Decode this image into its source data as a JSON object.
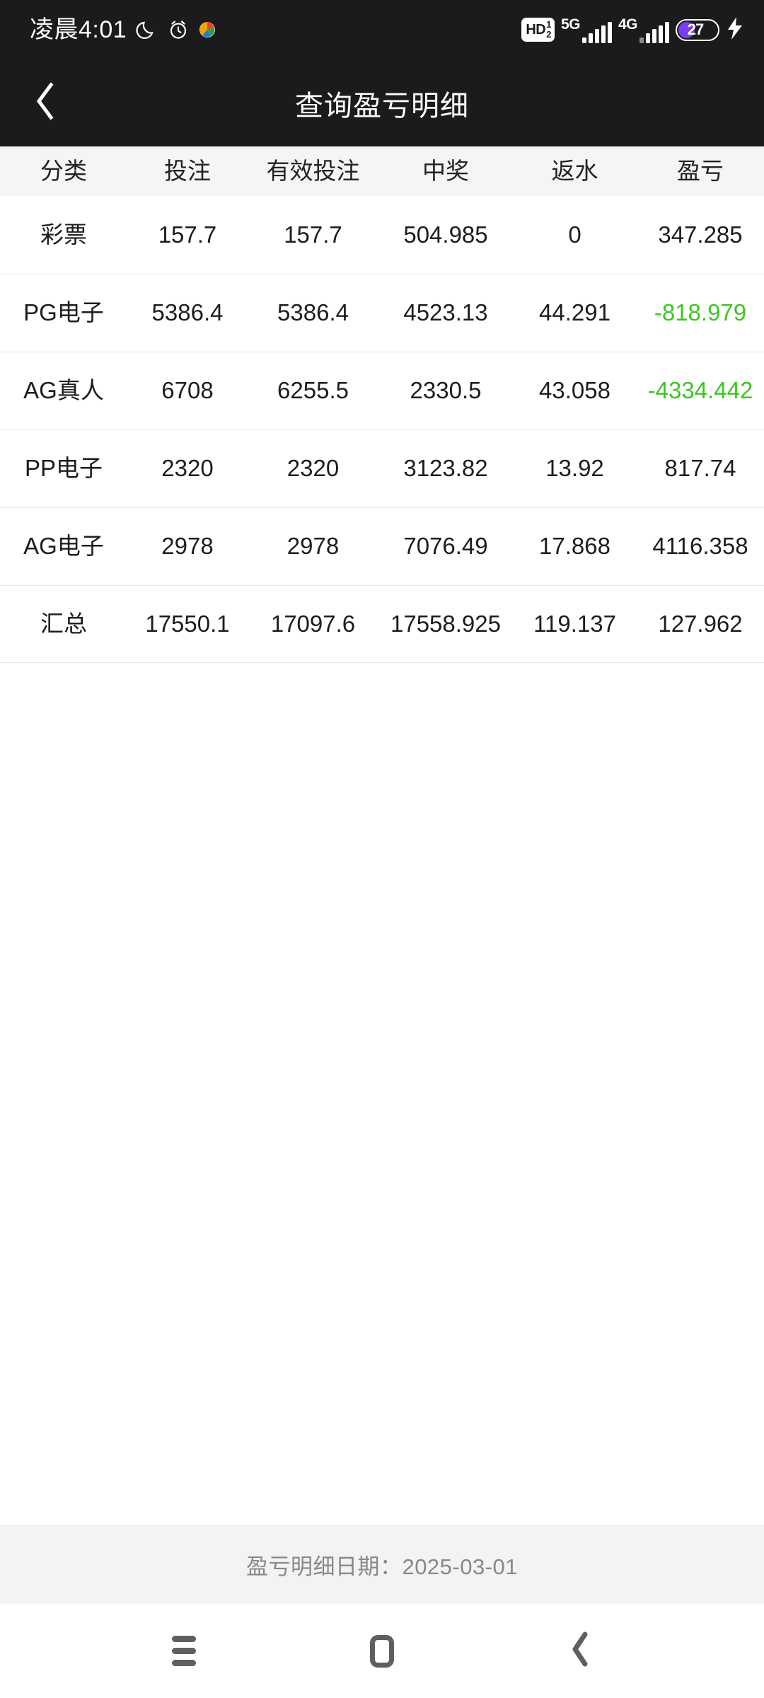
{
  "status_bar": {
    "clock": "凌晨4:01",
    "dnd_icon": "crescent-moon-icon",
    "alarm_icon": "alarm-clock-icon",
    "app_icon": "color-app-icon",
    "hd_label": "HD",
    "hd_sub_top": "1",
    "hd_sub_bottom": "2",
    "network_primary": "5G",
    "network_secondary": "4G",
    "battery_percent": "27",
    "battery_fill_color": "#7b3ff2",
    "charging_icon": "lightning-bolt-icon"
  },
  "appbar": {
    "back_icon": "chevron-left-icon",
    "title": "查询盈亏明细"
  },
  "table": {
    "columns": [
      "分类",
      "投注",
      "有效投注",
      "中奖",
      "返水",
      "盈亏"
    ],
    "rows": [
      {
        "cells": [
          "彩票",
          "157.7",
          "157.7",
          "504.985",
          "0",
          "347.285"
        ],
        "profit_negative": false
      },
      {
        "cells": [
          "PG电子",
          "5386.4",
          "5386.4",
          "4523.13",
          "44.291",
          "-818.979"
        ],
        "profit_negative": true
      },
      {
        "cells": [
          "AG真人",
          "6708",
          "6255.5",
          "2330.5",
          "43.058",
          "-4334.442"
        ],
        "profit_negative": true
      },
      {
        "cells": [
          "PP电子",
          "2320",
          "2320",
          "3123.82",
          "13.92",
          "817.74"
        ],
        "profit_negative": false
      },
      {
        "cells": [
          "AG电子",
          "2978",
          "2978",
          "7076.49",
          "17.868",
          "4116.358"
        ],
        "profit_negative": false
      },
      {
        "cells": [
          "汇总",
          "17550.1",
          "17097.6",
          "17558.925",
          "119.137",
          "127.962"
        ],
        "profit_negative": false
      }
    ],
    "negative_color": "#3dc521"
  },
  "footer": {
    "note": "盈亏明细日期：2025-03-01"
  },
  "navbar": {
    "recents_icon": "recents-icon",
    "home_icon": "home-icon",
    "back_icon": "chevron-left-icon"
  }
}
